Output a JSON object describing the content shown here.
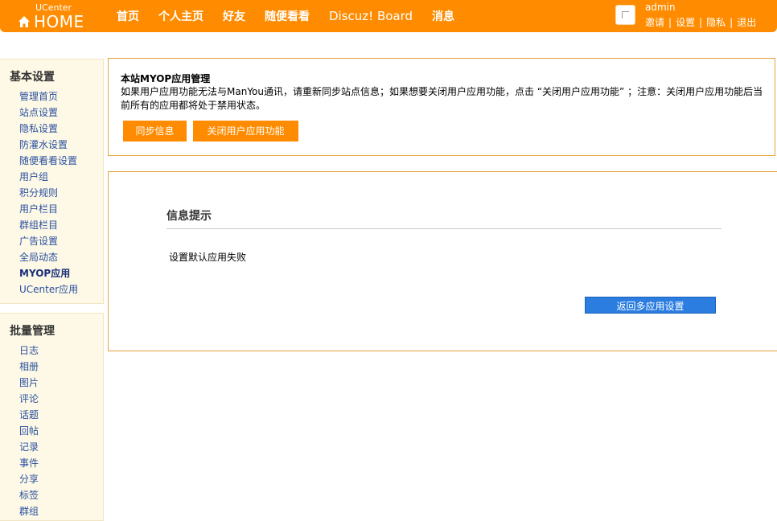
{
  "header": {
    "logo_small": "UCenter",
    "logo_big": "HOME",
    "nav": [
      "首页",
      "个人主页",
      "好友",
      "随便看看",
      "Discuz! Board",
      "消息"
    ],
    "username": "admin",
    "user_links": [
      "邀请",
      "设置",
      "隐私",
      "退出"
    ]
  },
  "sidebar": {
    "basic_title": "基本设置",
    "basic_items": [
      "管理首页",
      "站点设置",
      "隐私设置",
      "防灌水设置",
      "随便看看设置",
      "用户组",
      "积分规则",
      "用户栏目",
      "群组栏目",
      "广告设置",
      "全局动态",
      "MYOP应用",
      "UCenter应用"
    ],
    "batch_title": "批量管理",
    "batch_items": [
      "日志",
      "相册",
      "图片",
      "评论",
      "话题",
      "回帖",
      "记录",
      "事件",
      "分享",
      "标签",
      "群组"
    ]
  },
  "myop": {
    "title": "本站MYOP应用管理",
    "description": "如果用户应用功能无法与ManYou通讯，请重新同步站点信息；如果想要关闭用户应用功能，点击 “关闭用户应用功能” ；注意：关闭用户应用功能后当前所有的应用都将处于禁用状态。",
    "sync_button": "同步信息",
    "close_button": "关闭用户应用功能"
  },
  "message": {
    "title": "信息提示",
    "text": "设置默认应用失败",
    "back_button": "返回多应用设置"
  }
}
